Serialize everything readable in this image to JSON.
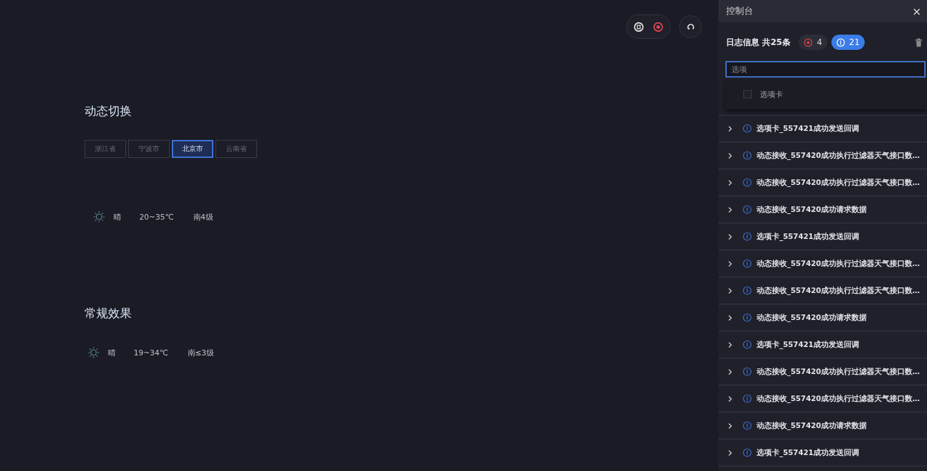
{
  "controls": {
    "pause": {
      "on": false
    },
    "record": {
      "on": true
    }
  },
  "sections": [
    {
      "title": "动态切换",
      "tabs": [
        {
          "label": "浙江省",
          "selected": false
        },
        {
          "label": "宁波市",
          "selected": false
        },
        {
          "label": "北京市",
          "selected": true
        },
        {
          "label": "云南省",
          "selected": false
        }
      ],
      "weather": {
        "condition": "晴",
        "temperature": "20~35℃",
        "wind": "南4级"
      }
    },
    {
      "title": "常规效果",
      "weather": {
        "condition": "晴",
        "temperature": "19~34℃",
        "wind": "南≤3级"
      }
    }
  ],
  "console": {
    "title": "控制台",
    "close": "×",
    "log_summary": "日志信息 共25条",
    "filters": [
      {
        "kind": "error",
        "count": "4",
        "selected": false
      },
      {
        "kind": "info",
        "count": "21",
        "selected": true
      }
    ],
    "search": {
      "placeholder": "选项"
    },
    "dropdown": {
      "options": [
        {
          "label": "选项卡",
          "checked": false
        }
      ]
    },
    "logs": [
      {
        "kind": "info",
        "text": "选项卡_557421成功发送回调",
        "expanded": false
      },
      {
        "kind": "info",
        "text": "动态接收_557420成功执行过滤器天气接口数…",
        "expanded": false
      },
      {
        "kind": "info",
        "text": "动态接收_557420成功执行过滤器天气接口数…",
        "expanded": false
      },
      {
        "kind": "info",
        "text": "动态接收_557420成功请求数据",
        "expanded": false
      },
      {
        "kind": "info",
        "text": "选项卡_557421成功发送回调",
        "expanded": false
      },
      {
        "kind": "info",
        "text": "动态接收_557420成功执行过滤器天气接口数…",
        "expanded": false
      },
      {
        "kind": "info",
        "text": "动态接收_557420成功执行过滤器天气接口数…",
        "expanded": false
      },
      {
        "kind": "info",
        "text": "动态接收_557420成功请求数据",
        "expanded": false
      },
      {
        "kind": "info",
        "text": "选项卡_557421成功发送回调",
        "expanded": false
      },
      {
        "kind": "info",
        "text": "动态接收_557420成功执行过滤器天气接口数…",
        "expanded": false
      },
      {
        "kind": "info",
        "text": "动态接收_557420成功执行过滤器天气接口数…",
        "expanded": false
      },
      {
        "kind": "info",
        "text": "动态接收_557420成功请求数据",
        "expanded": false
      },
      {
        "kind": "info",
        "text": "选项卡_557421成功发送回调",
        "expanded": false
      }
    ]
  }
}
